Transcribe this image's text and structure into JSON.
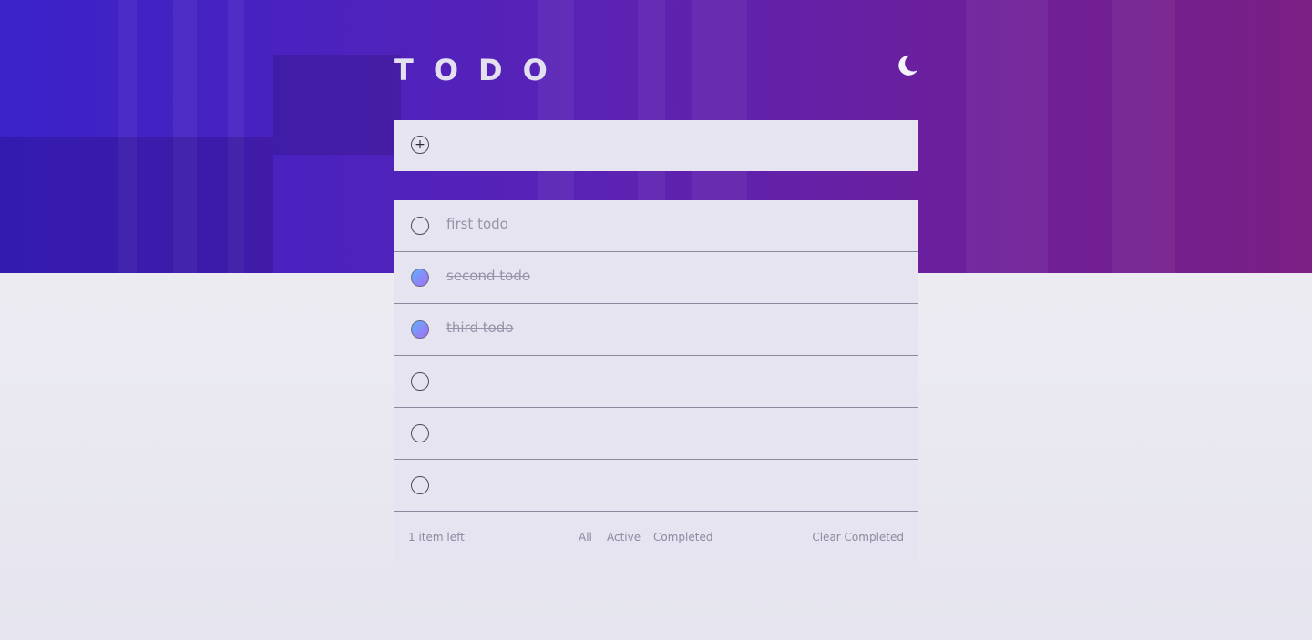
{
  "app": {
    "title": "TODO",
    "theme_icon": "moon-icon"
  },
  "new_todo": {
    "value": "",
    "placeholder": "",
    "add_icon": "plus-circle-icon"
  },
  "todos": [
    {
      "text": "first todo",
      "completed": false
    },
    {
      "text": "second todo",
      "completed": true
    },
    {
      "text": "third todo",
      "completed": true
    },
    {
      "text": "",
      "completed": false
    },
    {
      "text": "",
      "completed": false
    },
    {
      "text": "",
      "completed": false
    }
  ],
  "footer": {
    "items_left": "1 item left",
    "filter_all": "All",
    "filter_active": "Active",
    "filter_completed": "Completed",
    "clear_completed": "Clear Completed"
  },
  "colors": {
    "check_gradient_start": "#5fb2ff",
    "check_gradient_end": "#a86bf2",
    "card_bg": "#e5e4f0"
  }
}
